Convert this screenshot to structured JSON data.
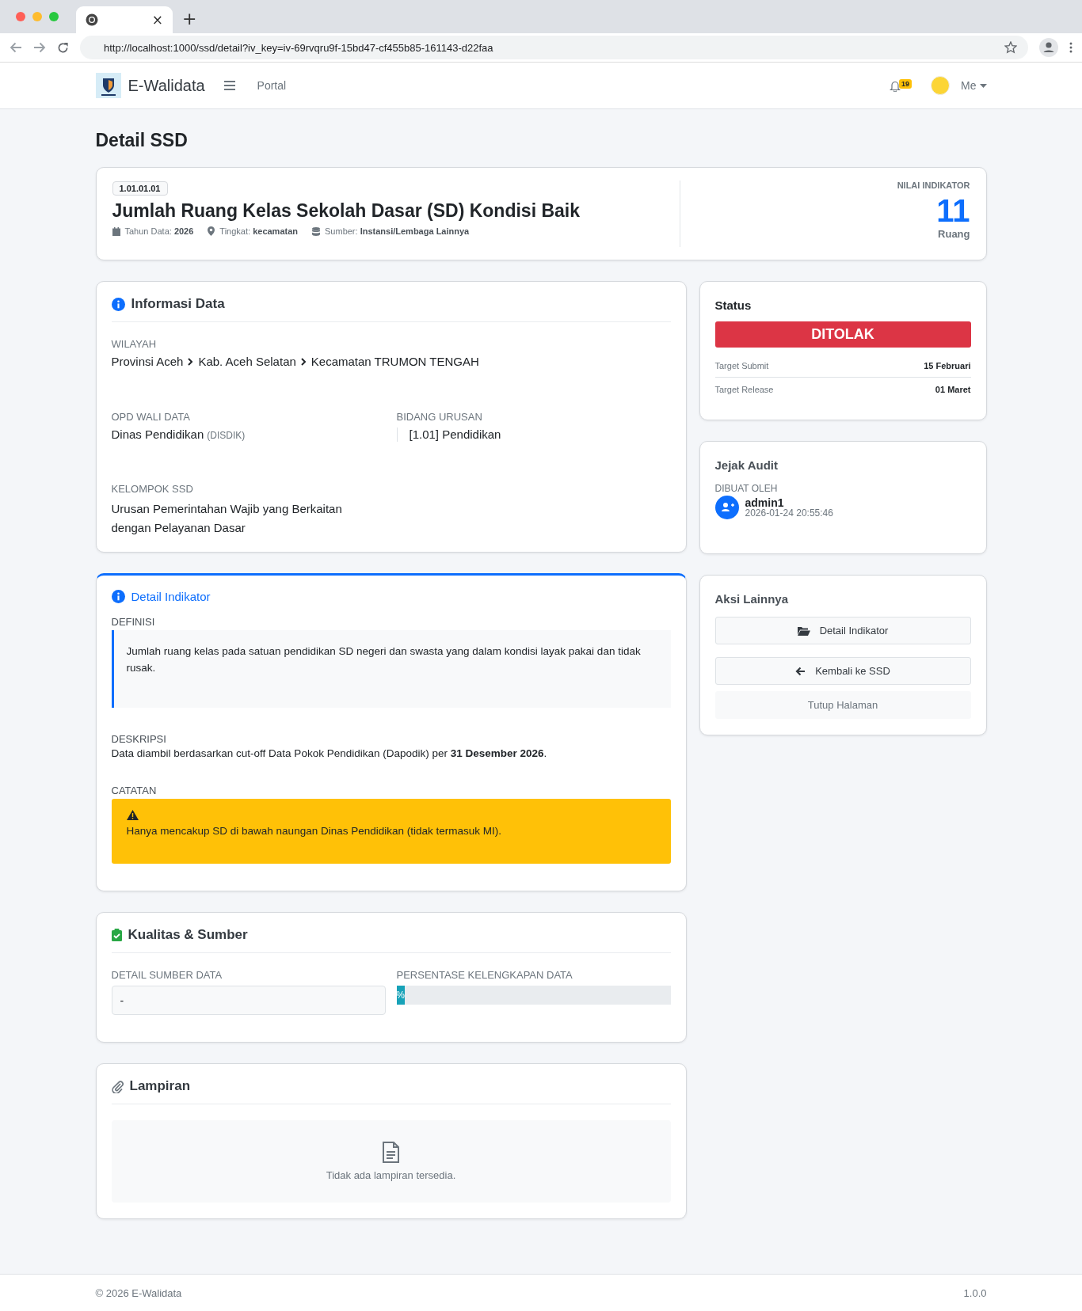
{
  "browser": {
    "tab_close": "×",
    "new_tab": "+",
    "url": "http://localhost:1000/ssd/detail?iv_key=iv-69rvqru9f-15bd47-cf455b85-161143-d22faa"
  },
  "navbar": {
    "brand": "E-Walidata",
    "link": "Portal",
    "notification_count": "19",
    "user": "Me"
  },
  "page_title": "Detail SSD",
  "header": {
    "code": "1.01.01.01",
    "title": "Jumlah Ruang Kelas Sekolah Dasar (SD) Kondisi Baik",
    "meta": [
      {
        "kind": "year",
        "text": "Tahun Data: **2026**"
      },
      {
        "kind": "level",
        "text": "Tingkat: **kecamatan**"
      },
      {
        "kind": "source",
        "text": "Sumber: **Instansi/Lembaga Lainnya**"
      }
    ],
    "value_label": "NILAI INDIKATOR",
    "value": "11",
    "unit": "Ruang"
  },
  "info": {
    "title": "Informasi Data",
    "wilayah_label": "WILAYAH",
    "wilayah": [
      "Provinsi Aceh",
      "Kab. Aceh Selatan",
      "Kecamatan TRUMON TENGAH"
    ],
    "opd_label": "OPD WALI DATA",
    "opd_name": "Dinas Pendidikan",
    "opd_abbreviation": "(DISDIK)",
    "bidang_label": "BIDANG URUSAN",
    "bidang": "[1.01] Pendidikan",
    "kelompok_label": "KELOMPOK SSD",
    "kelompok": "Urusan Pemerintahan Wajib yang Berkaitan dengan Pelayanan Dasar"
  },
  "indikator": {
    "title": "Detail Indikator",
    "definisi_label": "DEFINISI",
    "definisi": "Jumlah ruang kelas pada satuan pendidikan SD negeri dan swasta yang dalam kondisi layak pakai dan tidak rusak.",
    "deskripsi_label": "DESKRIPSI",
    "deskripsi": "Data diambil berdasarkan cut-off Data Pokok Pendidikan (Dapodik) per **31 Desember 2026**.",
    "catatan_label": "CATATAN",
    "catatan": "Hanya mencakup SD di bawah naungan Dinas Pendidikan (tidak termasuk MI)."
  },
  "kualitas": {
    "title": "Kualitas & Sumber",
    "sumber_label": "DETAIL SUMBER DATA",
    "sumber_value": "-",
    "persen_label": "PERSENTASE KELENGKAPAN DATA",
    "level": 0.03,
    "progress_text": "%"
  },
  "lampiran": {
    "title": "Lampiran",
    "empty_text": "Tidak ada lampiran tersedia."
  },
  "status": {
    "title": "Status",
    "badge": "DITOLAK",
    "kind": "rejected",
    "rows": [
      {
        "label": "Target Submit",
        "value": "15 Februari"
      },
      {
        "label": "Target Release",
        "value": "01 Maret"
      }
    ]
  },
  "audit": {
    "title": "Jejak Audit",
    "label": "DIBUAT OLEH",
    "user": "admin1",
    "time": "2026-01-24 20:55:46"
  },
  "actions": {
    "title": "Aksi Lainnya",
    "buttons": [
      {
        "label": "Detail Indikator",
        "kind": "detail"
      },
      {
        "label": "Kembali ke SSD",
        "kind": "back"
      },
      {
        "label": "Tutup Halaman",
        "kind": "close"
      }
    ]
  },
  "footer": {
    "copyright": "© 2026 E-Walidata",
    "version": "1.0.0"
  }
}
